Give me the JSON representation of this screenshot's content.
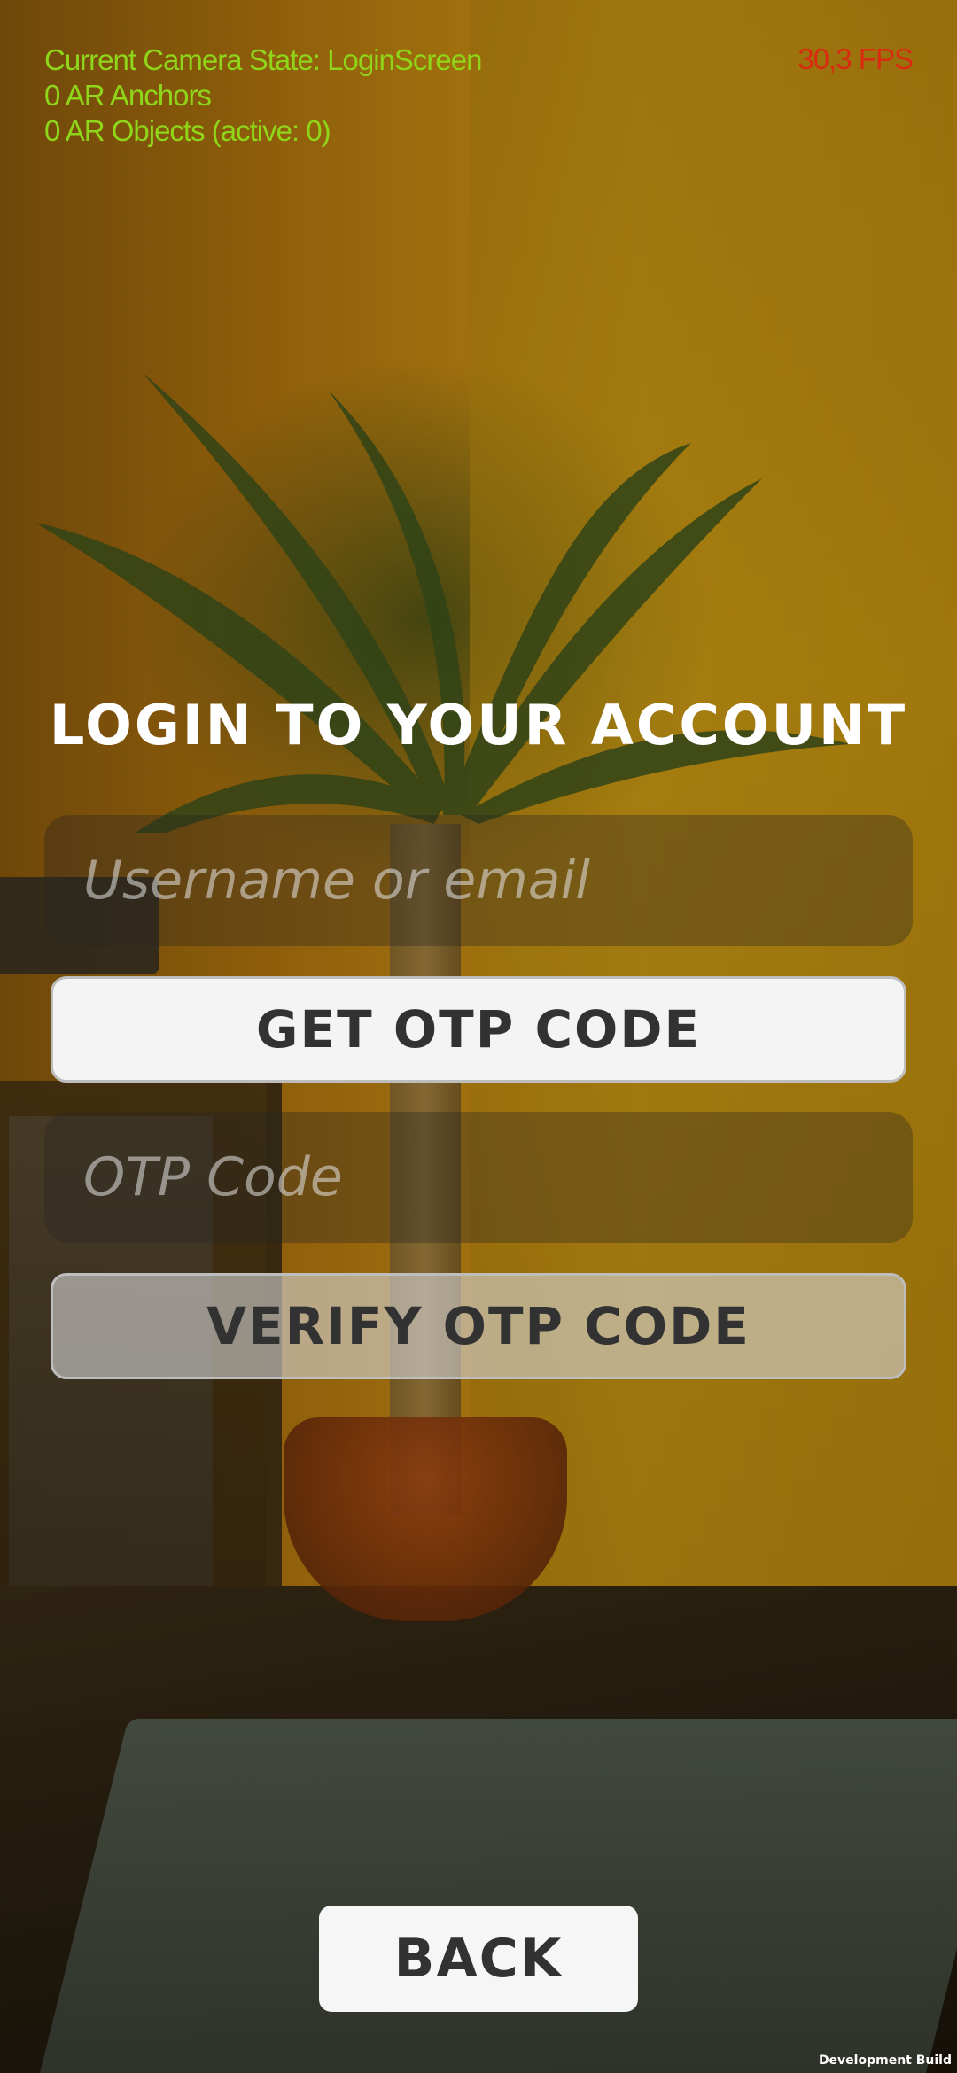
{
  "debug": {
    "camera_state": "Current Camera State: LoginScreen",
    "anchors": "0 AR Anchors",
    "objects": "0 AR Objects (active: 0)",
    "fps": "30,3 FPS"
  },
  "login": {
    "title": "LOGIN TO YOUR ACCOUNT",
    "username_placeholder": "Username or email",
    "get_otp_label": "GET OTP CODE",
    "otp_placeholder": "OTP Code",
    "verify_otp_label": "VERIFY OTP CODE",
    "back_label": "BACK"
  },
  "footer": {
    "build_label": "Development Build"
  },
  "colors": {
    "debug_text": "#8fd61a",
    "fps_text": "#d92b10",
    "button_text": "#323232"
  }
}
